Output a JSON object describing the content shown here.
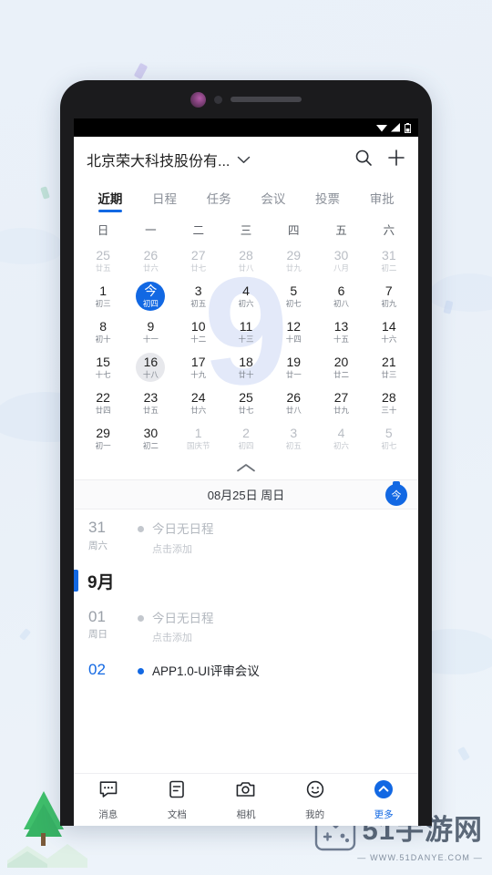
{
  "background": {
    "accent": "#1268e3",
    "page_bg": "#eaf1f9"
  },
  "watermark": {
    "title": "51手游网",
    "url": "— WWW.51DANYE.COM —"
  },
  "status_bar": {
    "wifi": "wifi-icon",
    "signal": "signal-icon",
    "battery": "battery-icon"
  },
  "header": {
    "org_name": "北京荣大科技股份有...",
    "dropdown_icon": "chevron-down-icon",
    "search_icon": "search-icon",
    "add_icon": "plus-icon"
  },
  "tabs": [
    {
      "label": "近期",
      "active": true
    },
    {
      "label": "日程",
      "active": false
    },
    {
      "label": "任务",
      "active": false
    },
    {
      "label": "会议",
      "active": false
    },
    {
      "label": "投票",
      "active": false
    },
    {
      "label": "审批",
      "active": false
    }
  ],
  "calendar": {
    "month_watermark": "9",
    "weekdays": [
      "日",
      "一",
      "二",
      "三",
      "四",
      "五",
      "六"
    ],
    "collapse_icon": "chevron-up-icon",
    "weeks": [
      [
        {
          "num": "25",
          "lunar": "廿五",
          "state": "muted"
        },
        {
          "num": "26",
          "lunar": "廿六",
          "state": "muted"
        },
        {
          "num": "27",
          "lunar": "廿七",
          "state": "muted"
        },
        {
          "num": "28",
          "lunar": "廿八",
          "state": "muted"
        },
        {
          "num": "29",
          "lunar": "廿九",
          "state": "muted"
        },
        {
          "num": "30",
          "lunar": "八月",
          "state": "muted"
        },
        {
          "num": "31",
          "lunar": "初二",
          "state": "muted"
        }
      ],
      [
        {
          "num": "1",
          "lunar": "初三",
          "state": "normal"
        },
        {
          "num": "今",
          "lunar": "初四",
          "state": "today"
        },
        {
          "num": "3",
          "lunar": "初五",
          "state": "normal"
        },
        {
          "num": "4",
          "lunar": "初六",
          "state": "normal"
        },
        {
          "num": "5",
          "lunar": "初七",
          "state": "normal"
        },
        {
          "num": "6",
          "lunar": "初八",
          "state": "normal"
        },
        {
          "num": "7",
          "lunar": "初九",
          "state": "normal"
        }
      ],
      [
        {
          "num": "8",
          "lunar": "初十",
          "state": "normal"
        },
        {
          "num": "9",
          "lunar": "十一",
          "state": "normal"
        },
        {
          "num": "10",
          "lunar": "十二",
          "state": "normal"
        },
        {
          "num": "11",
          "lunar": "十三",
          "state": "normal"
        },
        {
          "num": "12",
          "lunar": "十四",
          "state": "normal"
        },
        {
          "num": "13",
          "lunar": "十五",
          "state": "normal"
        },
        {
          "num": "14",
          "lunar": "十六",
          "state": "normal"
        }
      ],
      [
        {
          "num": "15",
          "lunar": "十七",
          "state": "normal"
        },
        {
          "num": "16",
          "lunar": "十八",
          "state": "selected"
        },
        {
          "num": "17",
          "lunar": "十九",
          "state": "normal"
        },
        {
          "num": "18",
          "lunar": "廿十",
          "state": "normal"
        },
        {
          "num": "19",
          "lunar": "廿一",
          "state": "normal"
        },
        {
          "num": "20",
          "lunar": "廿二",
          "state": "normal"
        },
        {
          "num": "21",
          "lunar": "廿三",
          "state": "normal"
        }
      ],
      [
        {
          "num": "22",
          "lunar": "廿四",
          "state": "normal"
        },
        {
          "num": "23",
          "lunar": "廿五",
          "state": "normal"
        },
        {
          "num": "24",
          "lunar": "廿六",
          "state": "normal"
        },
        {
          "num": "25",
          "lunar": "廿七",
          "state": "normal"
        },
        {
          "num": "26",
          "lunar": "廿八",
          "state": "normal"
        },
        {
          "num": "27",
          "lunar": "廿九",
          "state": "normal"
        },
        {
          "num": "28",
          "lunar": "三十",
          "state": "normal"
        }
      ],
      [
        {
          "num": "29",
          "lunar": "初一",
          "state": "normal"
        },
        {
          "num": "30",
          "lunar": "初二",
          "state": "normal"
        },
        {
          "num": "1",
          "lunar": "国庆节",
          "state": "muted"
        },
        {
          "num": "2",
          "lunar": "初四",
          "state": "muted"
        },
        {
          "num": "3",
          "lunar": "初五",
          "state": "muted"
        },
        {
          "num": "4",
          "lunar": "初六",
          "state": "muted"
        },
        {
          "num": "5",
          "lunar": "初七",
          "state": "muted"
        }
      ]
    ]
  },
  "date_strip": {
    "text": "08月25日 周日",
    "today_badge": "今"
  },
  "agenda": {
    "rows": [
      {
        "day": "31",
        "weekday": "周六",
        "day_highlight": false,
        "dot": "gray",
        "title": "今日无日程",
        "title_solid": false,
        "sub": "点击添加"
      }
    ],
    "month_separator": "9月",
    "rows2": [
      {
        "day": "01",
        "weekday": "周日",
        "day_highlight": false,
        "dot": "gray",
        "title": "今日无日程",
        "title_solid": false,
        "sub": "点击添加"
      },
      {
        "day": "02",
        "weekday": "",
        "day_highlight": true,
        "dot": "blue",
        "title": "APP1.0-UI评审会议",
        "title_solid": true,
        "sub": ""
      }
    ]
  },
  "bottom_nav": [
    {
      "label": "消息",
      "icon": "chat-bubble-icon",
      "active": false
    },
    {
      "label": "文档",
      "icon": "document-icon",
      "active": false
    },
    {
      "label": "相机",
      "icon": "camera-icon",
      "active": false
    },
    {
      "label": "我的",
      "icon": "smiley-face-icon",
      "active": false
    },
    {
      "label": "更多",
      "icon": "more-chevron-icon",
      "active": true
    }
  ]
}
